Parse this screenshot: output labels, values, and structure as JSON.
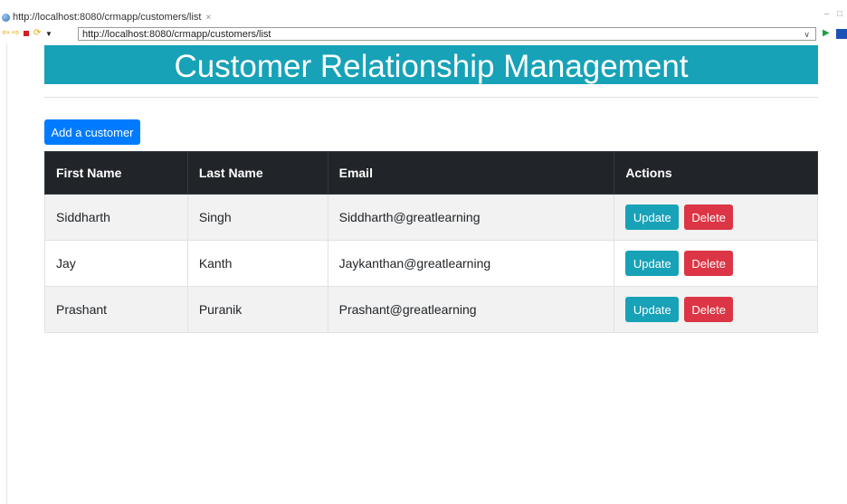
{
  "browser": {
    "tab_title": "http://localhost:8080/crmapp/customers/list",
    "tab_close": "×",
    "url": "http://localhost:8080/crmapp/customers/list",
    "window_controls": "– □"
  },
  "page": {
    "title": "Customer Relationship Management",
    "add_button": "Add a customer"
  },
  "table": {
    "headers": [
      "First Name",
      "Last Name",
      "Email",
      "Actions"
    ],
    "rows": [
      {
        "first": "Siddharth",
        "last": "Singh",
        "email": "Siddharth@greatlearning",
        "update": "Update",
        "delete": "Delete"
      },
      {
        "first": "Jay",
        "last": "Kanth",
        "email": "Jaykanthan@greatlearning",
        "update": "Update",
        "delete": "Delete"
      },
      {
        "first": "Prashant",
        "last": "Puranik",
        "email": "Prashant@greatlearning",
        "update": "Update",
        "delete": "Delete"
      }
    ]
  },
  "colors": {
    "header_bg": "#17a2b8",
    "primary": "#007bff",
    "danger": "#dc3545",
    "table_head": "#212529"
  },
  "icons": [
    "globe-icon",
    "back-arrow-icon",
    "forward-arrow-icon",
    "stop-icon",
    "refresh-icon",
    "dropdown-icon",
    "chevron-down-icon",
    "go-icon",
    "extension-icon"
  ]
}
